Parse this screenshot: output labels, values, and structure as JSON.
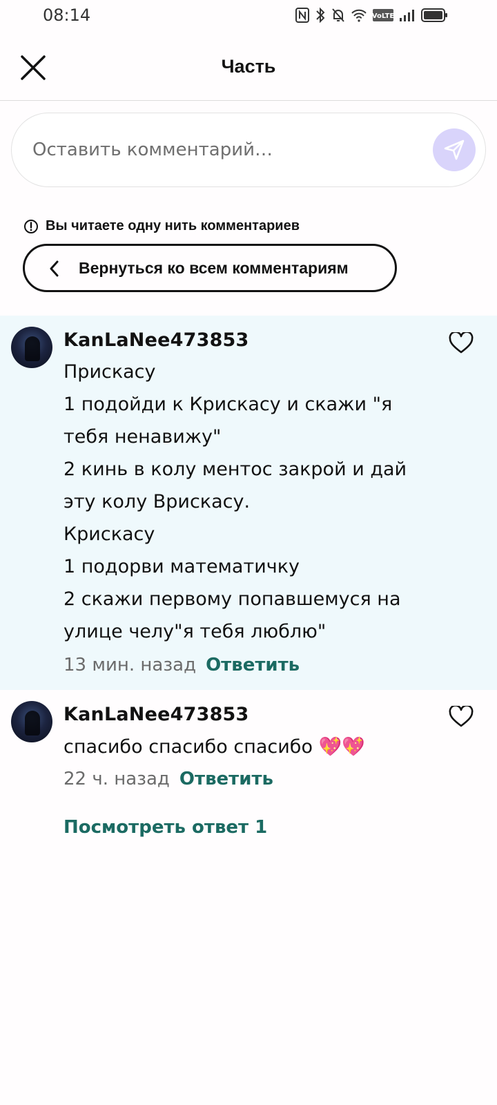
{
  "status_bar": {
    "time": "08:14",
    "icons": [
      "nfc-icon",
      "bluetooth-icon",
      "mute-icon",
      "wifi-icon",
      "volte-icon",
      "signal-icon",
      "battery-icon"
    ]
  },
  "header": {
    "title": "Часть",
    "close_icon": "close-icon"
  },
  "comment_input": {
    "placeholder": "Оставить комментарий…",
    "send_icon": "send-icon",
    "send_color": "#d9d4fb"
  },
  "thread_notice": {
    "text": "Вы читаете одну нить комментариев",
    "back_label": "Вернуться ко всем комментариям"
  },
  "comments": [
    {
      "username": "KanLaNee473853",
      "lines": [
        "Прискасу",
        "1 подойди к Крискасу и скажи \"я",
        "тебя ненавижу\"",
        "2 кинь в колу ментос закрой и дай",
        "эту колу Врискасу.",
        "Крискасу",
        "1 подорви математичку",
        "2 скажи первому попавшемуся на",
        "улице челу\"я тебя люблю\""
      ],
      "time": "13 мин. назад",
      "reply_label": "Ответить",
      "highlighted": true
    },
    {
      "username": "KanLaNee473853",
      "lines": [
        "спасибо спасибо спасибо 💖💖"
      ],
      "time": "22 ч. назад",
      "reply_label": "Ответить",
      "highlighted": false
    }
  ],
  "view_replies_label": "Посмотреть ответ 1",
  "colors": {
    "accent": "#1b6a62",
    "highlight_bg": "#eff9fc"
  }
}
